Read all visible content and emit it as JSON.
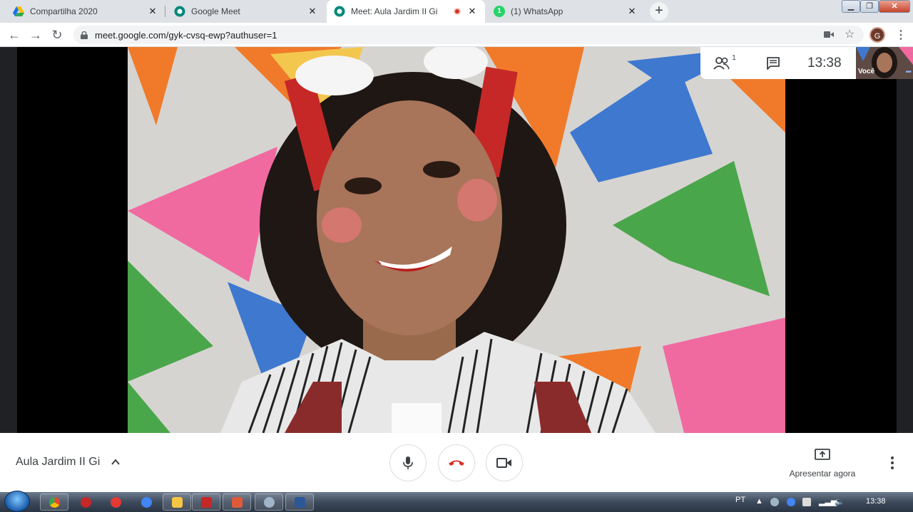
{
  "browser": {
    "tabs": [
      {
        "title": "Compartilha 2020",
        "favicon": "drive-icon",
        "close": "✕"
      },
      {
        "title": "Google Meet",
        "favicon": "meet-icon",
        "close": "✕"
      },
      {
        "title": "Meet: Aula Jardim II Gi",
        "favicon": "meet-icon",
        "close": "✕",
        "active": true,
        "recording": true
      },
      {
        "title": "(1) WhatsApp",
        "favicon": "whatsapp-icon",
        "badge": "1",
        "close": "✕"
      }
    ],
    "new_tab": "+",
    "url": "meet.google.com/gyk-cvsq-ewp?authuser=1",
    "profile_initial": "G"
  },
  "meet": {
    "participants_badge": "1",
    "clock": "13:38",
    "self_label": "Você",
    "meeting_title": "Aula Jardim II Gi",
    "present_label": "Apresentar agora",
    "colors": {
      "end_call": "#d93025",
      "accent": "#1a73e8"
    }
  },
  "taskbar": {
    "language": "PT",
    "time": "13:38",
    "apps": [
      "chrome-icon",
      "media-player-icon",
      "opera-icon",
      "chrome-icon",
      "file-explorer-icon",
      "acrobat-icon",
      "app-icon",
      "paint-icon",
      "word-icon"
    ]
  }
}
